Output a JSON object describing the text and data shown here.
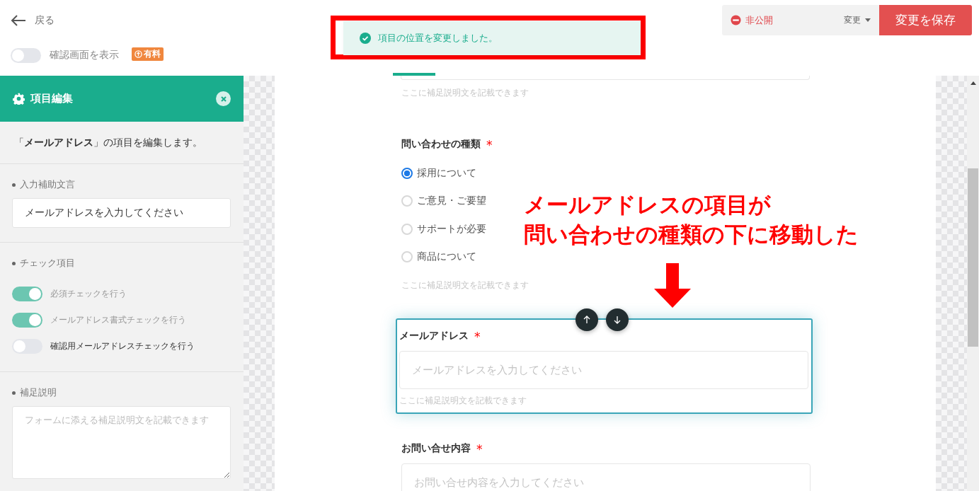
{
  "header": {
    "back_label": "戻る",
    "confirm_toggle": {
      "label": "確認画面を表示",
      "on": false,
      "badge": "有料"
    }
  },
  "toolbar": {
    "status": "非公開",
    "status_action": "変更",
    "save_button": "変更を保存"
  },
  "toast": "項目の位置を変更しました。",
  "panel": {
    "title": "項目編集",
    "intro": "「**メールアドレス**」の項目を編集します。",
    "sections": [
      {
        "kind": "input",
        "heading": "入力補助文言",
        "value": "メールアドレスを入力してください"
      },
      {
        "kind": "toggles",
        "heading": "チェック項目",
        "toggles": [
          {
            "label": "必須チェックを行う",
            "on": true
          },
          {
            "label": "メールアドレス書式チェックを行う",
            "on": true
          },
          {
            "label": "確認用メールアドレスチェックを行う",
            "on": false
          }
        ]
      },
      {
        "kind": "textarea",
        "heading": "補足説明",
        "placeholder": "フォームに添える補足説明文を記載できます"
      }
    ]
  },
  "form": {
    "fields": [
      {
        "kind": "fragment",
        "hint": "ここに補足説明文を記載できます",
        "selected": false
      },
      {
        "kind": "radio",
        "label": "問い合わせの種類",
        "required_mark": "*",
        "selected": false,
        "options": [
          {
            "label": "採用について",
            "selected": true
          },
          {
            "label": "ご意見・ご要望",
            "selected": false
          },
          {
            "label": "サポートが必要",
            "selected": false
          },
          {
            "label": "商品について",
            "selected": false
          }
        ],
        "hint": "ここに補足説明文を記載できます"
      },
      {
        "kind": "text",
        "label": "メールアドレス",
        "required_mark": "*",
        "selected": true,
        "placeholder": "メールアドレスを入力してください",
        "hint": "ここに補足説明文を記載できます"
      },
      {
        "kind": "text",
        "label": "お問い合せ内容",
        "required_mark": "*",
        "selected": false,
        "placeholder": "お問い合せ内容を入力してください"
      }
    ]
  },
  "annotation": {
    "lines": [
      "メールアドレスの項目が",
      "問い合わせの種類の下に移動した"
    ]
  }
}
